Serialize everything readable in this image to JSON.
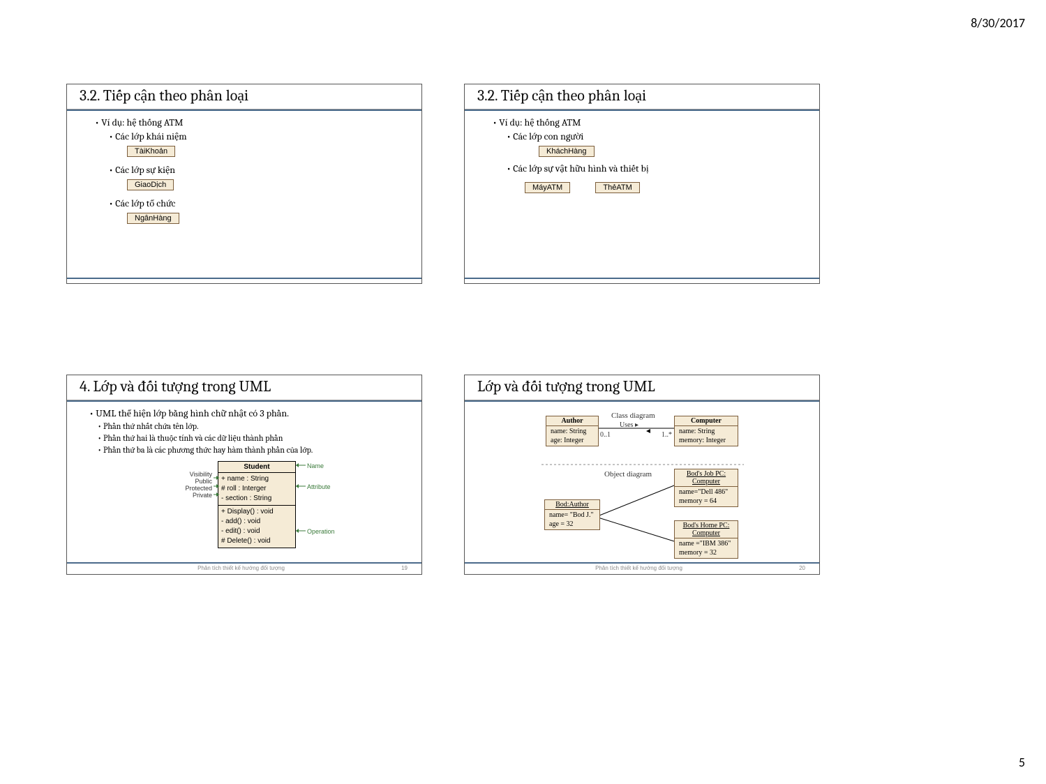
{
  "page": {
    "date": "8/30/2017",
    "number": "5"
  },
  "slide1": {
    "title": "3.2. Tiếp cận theo phân loại",
    "example": "Ví dụ: hệ thống ATM",
    "concept": "Các lớp khái niệm",
    "conceptClass": "TàiKhoản",
    "event": "Các lớp sự kiện",
    "eventClass": "GiaoDịch",
    "org": "Các lớp tổ chức",
    "orgClass": "NgânHàng"
  },
  "slide2": {
    "title": "3.2. Tiếp cận theo phân loại",
    "example": "Ví dụ: hệ thống ATM",
    "people": "Các lớp con người",
    "peopleClass": "KháchHàng",
    "thing": "Các lớp sự vật hữu hình và thiết bị",
    "thingClass1": "MáyATM",
    "thingClass2": "ThẻATM"
  },
  "slide3": {
    "title": "4. Lớp và đối tượng trong UML",
    "intro": "UML thể hiện lớp bằng hình chữ nhật có 3 phần.",
    "part1": "Phần thứ nhất chứa tên lớp.",
    "part2": "Phần thứ hai là thuộc tính và các dữ liệu thành phần",
    "part3": "Phần thứ ba là các phương thức hay hàm thành phần của lớp.",
    "uml": {
      "name": "Student",
      "attr1": "+ name : String",
      "attr2": "# roll : Interger",
      "attr3": "- section : String",
      "op1": "+ Display() : void",
      "op2": "- add() : void",
      "op3": "- edit() : void",
      "op4": "# Delete() : void"
    },
    "labels": {
      "visibility": "Visibility",
      "public": "Public",
      "protected": "Protected",
      "private": "Private",
      "name": "Name",
      "attribute": "Attribute",
      "operation": "Operation"
    },
    "footer": "Phân tích thiết kế hướng đối tượng",
    "slideNum": "19"
  },
  "slide4": {
    "title": "Lớp và đối tượng trong UML",
    "classDiagram": "Class diagram",
    "uses": "Uses",
    "objectDiagram": "Object diagram",
    "author": {
      "name": "Author",
      "a1": "name: String",
      "a2": "age: Integer"
    },
    "computer": {
      "name": "Computer",
      "a1": "name: String",
      "a2": "memory: Integer"
    },
    "mult1": "0..1",
    "mult2": "1..*",
    "bod": {
      "name": "Bod:Author",
      "a1": "name= \"Bod J.\"",
      "a2": "age = 32"
    },
    "jobpc": {
      "name": "Bod's Job PC: Computer",
      "a1": "name=\"Dell 486\"",
      "a2": "memory = 64"
    },
    "homepc": {
      "name": "Bod's Home PC: Computer",
      "a1": "name =\"IBM 386\"",
      "a2": "memory = 32"
    },
    "footer": "Phân tích thiết kế hướng đối tượng",
    "slideNum": "20"
  }
}
